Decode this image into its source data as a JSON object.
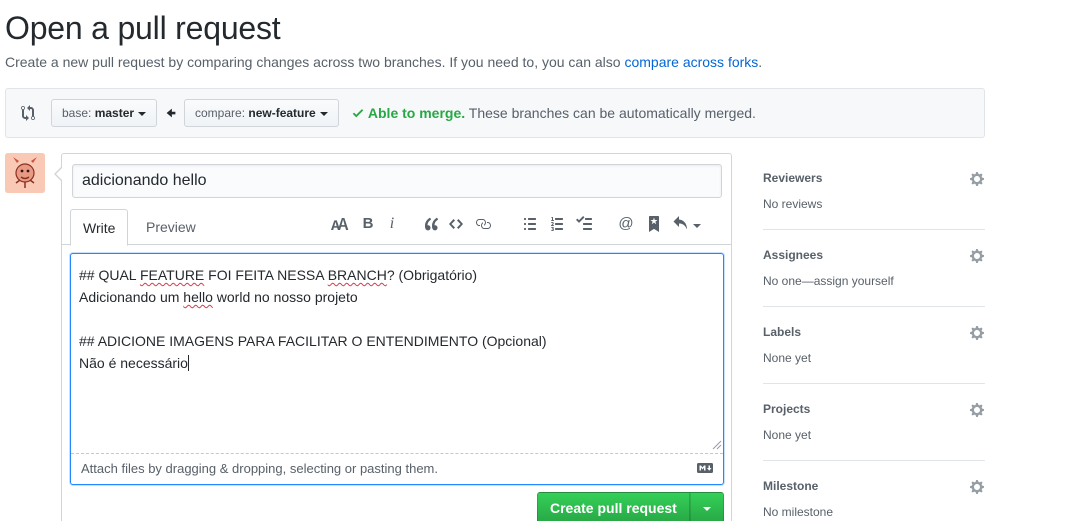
{
  "page": {
    "title": "Open a pull request",
    "subtitle_text": "Create a new pull request by comparing changes across two branches. If you need to, you can also ",
    "subtitle_link": "compare across forks",
    "subtitle_end": "."
  },
  "range": {
    "base_label": "base:",
    "base_value": "master",
    "compare_label": "compare:",
    "compare_value": "new-feature",
    "merge_ok": "Able to merge.",
    "merge_msg": " These branches can be automatically merged."
  },
  "composer": {
    "title_value": "adicionando hello",
    "tabs": [
      "Write",
      "Preview"
    ],
    "body_lines": [
      "## QUAL ",
      "FEATURE",
      " FOI FEITA NESSA ",
      "BRANCH",
      "? (Obrigatório)",
      "Adicionando um ",
      "hello",
      " world no nosso projeto",
      "## ADICIONE IMAGENS PARA FACILITAR O ENTENDIMENTO (Opcional)",
      "Não é necessário"
    ],
    "attach_hint": "Attach files by dragging & dropping, selecting or pasting them.",
    "submit_label": "Create pull request"
  },
  "toolbar": {
    "icons": [
      "text-size-icon",
      "bold-icon",
      "italic-icon",
      "quote-icon",
      "code-icon",
      "link-icon",
      "bullet-list-icon",
      "numbered-list-icon",
      "task-list-icon",
      "mention-icon",
      "bookmark-icon",
      "reply-icon"
    ],
    "bold_glyph": "B",
    "italic_glyph": "i",
    "mention_glyph": "@"
  },
  "sidebar": {
    "sections": [
      {
        "title": "Reviewers",
        "value": "No reviews"
      },
      {
        "title": "Assignees",
        "value": "No one—assign yourself"
      },
      {
        "title": "Labels",
        "value": "None yet"
      },
      {
        "title": "Projects",
        "value": "None yet"
      },
      {
        "title": "Milestone",
        "value": "No milestone"
      }
    ]
  },
  "colors": {
    "link": "#0366d6",
    "merge_ok": "#28a745",
    "focus": "#2188ff",
    "button_green": "#2ea44f"
  }
}
